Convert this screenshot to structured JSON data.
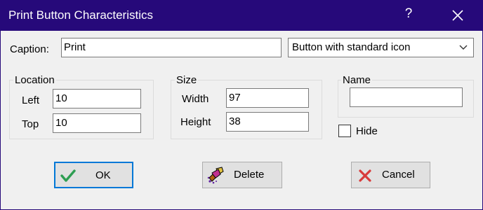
{
  "window": {
    "title": "Print Button Characteristics",
    "help_label": "?"
  },
  "caption": {
    "label": "Caption:",
    "value": "Print"
  },
  "button_style": {
    "selected": "Button with standard icon"
  },
  "location": {
    "legend": "Location",
    "left_label": "Left",
    "left_value": "10",
    "top_label": "Top",
    "top_value": "10"
  },
  "size": {
    "legend": "Size",
    "width_label": "Width",
    "width_value": "97",
    "height_label": "Height",
    "height_value": "38"
  },
  "name": {
    "legend": "Name",
    "value": ""
  },
  "hide": {
    "label": "Hide",
    "checked": false
  },
  "buttons": {
    "ok": "OK",
    "delete": "Delete",
    "cancel": "Cancel"
  },
  "colors": {
    "titlebar": "#26097a",
    "ok_check": "#2e9e52",
    "cancel_x": "#d83b3b",
    "default_border": "#0078d7"
  }
}
